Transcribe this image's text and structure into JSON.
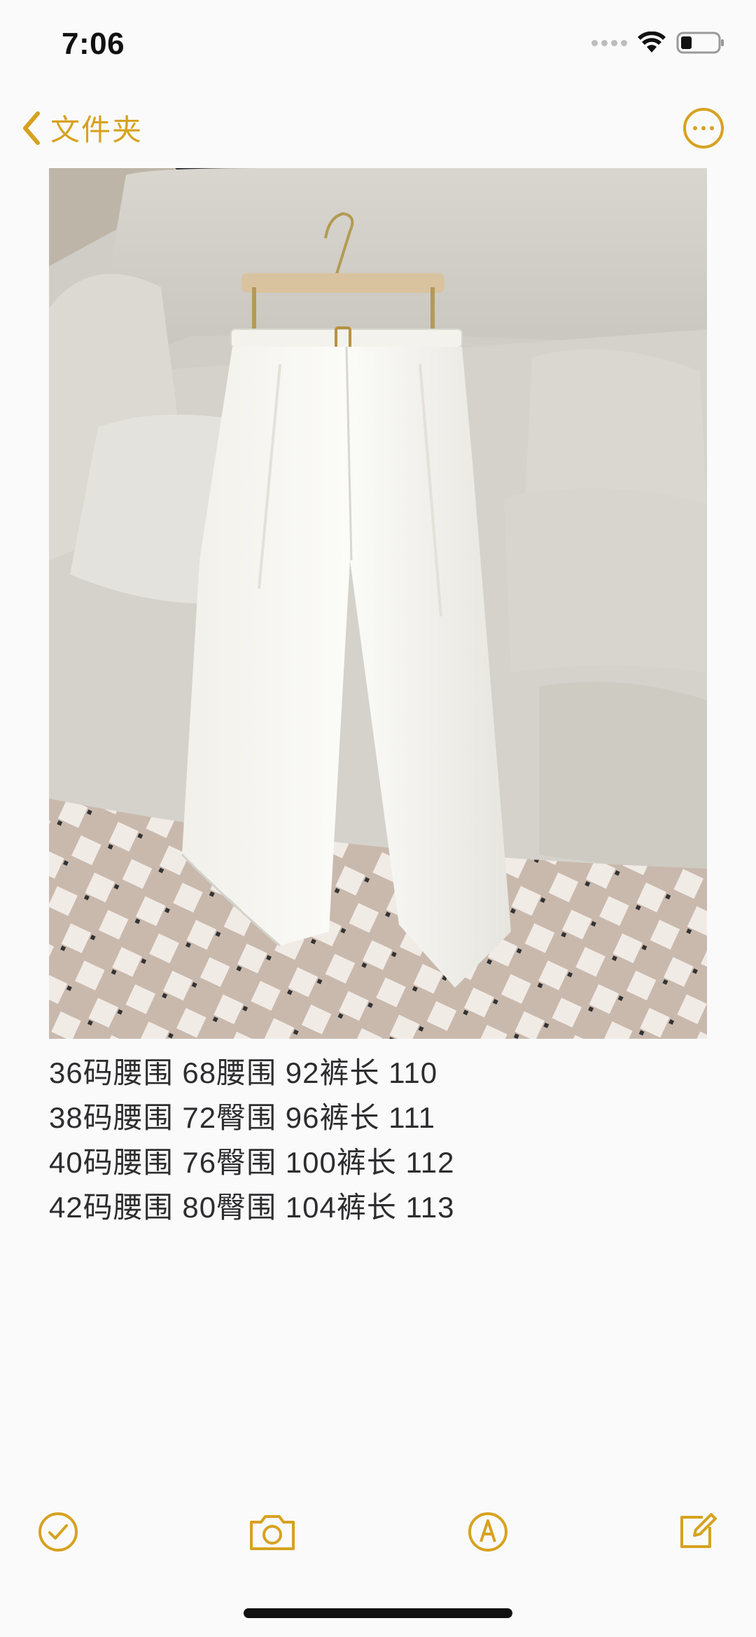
{
  "status_bar": {
    "time": "7:06",
    "signal_icon": "cellular-signal-icon",
    "wifi_icon": "wifi-icon",
    "battery_icon": "battery-icon"
  },
  "nav": {
    "back_label": "文件夹",
    "back_icon": "chevron-left-icon",
    "more_icon": "ellipsis-circle-icon",
    "accent_color": "#d6a21f"
  },
  "note": {
    "image": "photo of white belted trousers on a hanger over a sofa",
    "lines": [
      "36码腰围 68腰围 92裤长 110",
      "38码腰围 72臀围 96裤长 111",
      "40码腰围 76臀围 100裤长 112",
      "42码腰围 80臀围 104裤长 113"
    ]
  },
  "toolbar": {
    "checklist_icon": "checklist-icon",
    "camera_icon": "camera-icon",
    "markup_icon": "markup-pen-icon",
    "compose_icon": "compose-icon"
  }
}
